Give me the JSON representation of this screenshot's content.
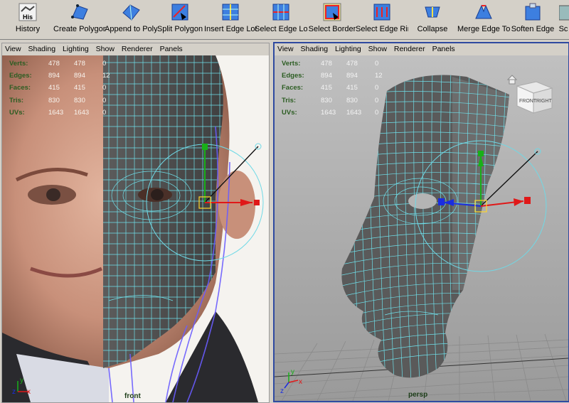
{
  "shelf": {
    "items": [
      {
        "label": "History",
        "icon": "history-icon",
        "badge": "His"
      },
      {
        "label": "Create Polygon",
        "icon": "create-polygon-icon"
      },
      {
        "label": "Append to Polygon",
        "icon": "append-polygon-icon"
      },
      {
        "label": "Split Polygon",
        "icon": "split-polygon-icon"
      },
      {
        "label": "Insert Edge Loop",
        "icon": "insert-edge-loop-icon"
      },
      {
        "label": "Select Edge Loop",
        "icon": "select-edge-loop-icon"
      },
      {
        "label": "Select Border",
        "icon": "select-border-icon"
      },
      {
        "label": "Select Edge Ring",
        "icon": "select-edge-ring-icon"
      },
      {
        "label": "Collapse",
        "icon": "collapse-icon"
      },
      {
        "label": "Merge Edge Tool",
        "icon": "merge-edge-icon"
      },
      {
        "label": "Soften Edge",
        "icon": "soften-edge-icon"
      },
      {
        "label": "Sc",
        "icon": "sculpt-icon"
      }
    ]
  },
  "front_panel": {
    "menu": [
      "View",
      "Shading",
      "Lighting",
      "Show",
      "Renderer",
      "Panels"
    ],
    "camera": "front",
    "hud": [
      {
        "label": "Verts:",
        "a": "478",
        "b": "478",
        "c": "0"
      },
      {
        "label": "Edges:",
        "a": "894",
        "b": "894",
        "c": "12"
      },
      {
        "label": "Faces:",
        "a": "415",
        "b": "415",
        "c": "0"
      },
      {
        "label": "Tris:",
        "a": "830",
        "b": "830",
        "c": "0"
      },
      {
        "label": "UVs:",
        "a": "1643",
        "b": "1643",
        "c": "0"
      }
    ]
  },
  "persp_panel": {
    "menu": [
      "View",
      "Shading",
      "Lighting",
      "Show",
      "Renderer",
      "Panels"
    ],
    "camera": "persp",
    "view_cube": {
      "front": "FRONT",
      "right": "RIGHT"
    },
    "hud": [
      {
        "label": "Verts:",
        "a": "478",
        "b": "478",
        "c": "0"
      },
      {
        "label": "Edges:",
        "a": "894",
        "b": "894",
        "c": "12"
      },
      {
        "label": "Faces:",
        "a": "415",
        "b": "415",
        "c": "0"
      },
      {
        "label": "Tris:",
        "a": "830",
        "b": "830",
        "c": "0"
      },
      {
        "label": "UVs:",
        "a": "1643",
        "b": "1643",
        "c": "0"
      }
    ]
  },
  "axis_labels": {
    "x": "x",
    "y": "y",
    "z": "z"
  },
  "colors": {
    "wire": "#6fe0ea",
    "mesh": "#555555",
    "active_border": "#2f4aa0",
    "manip_x": "#e01818",
    "manip_y": "#18b018",
    "manip_z": "#1a2de0"
  }
}
